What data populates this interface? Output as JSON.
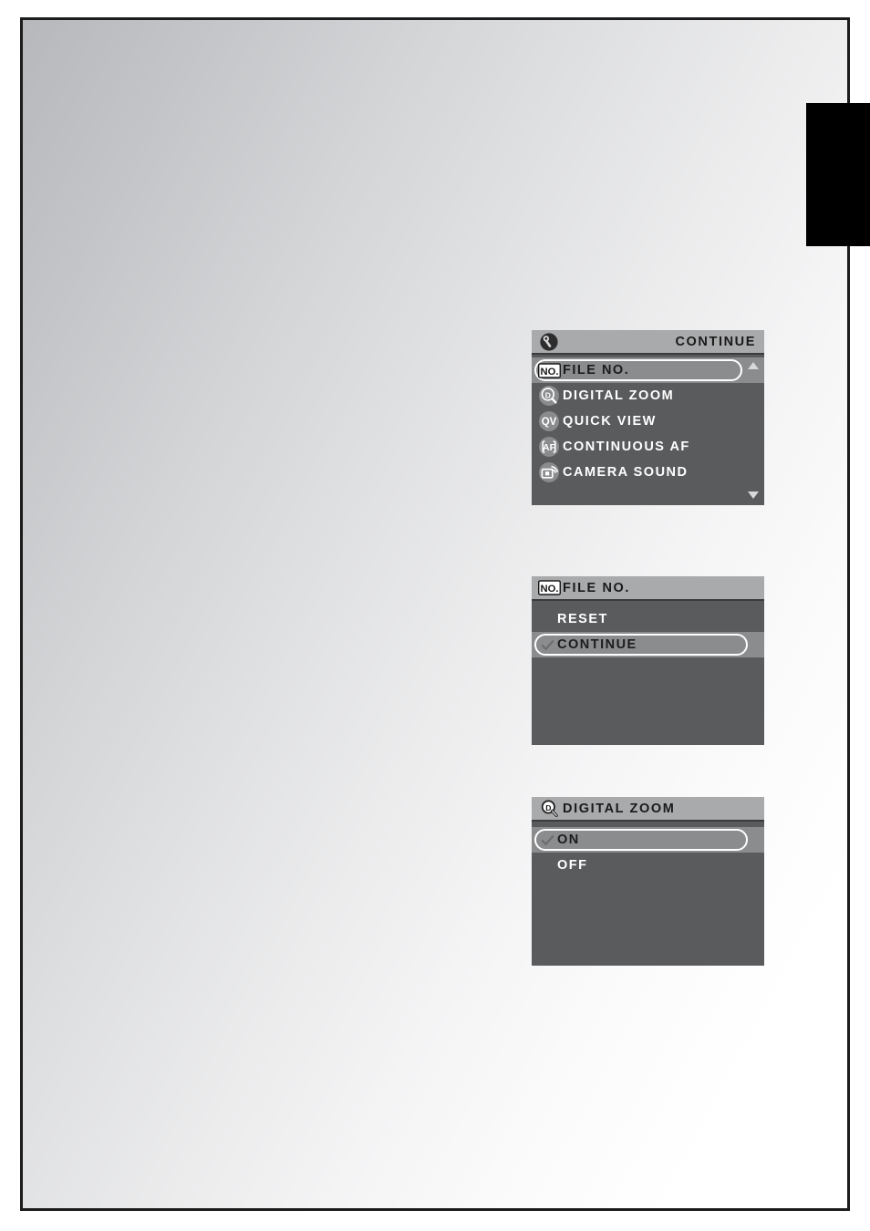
{
  "page": {
    "background_gradient_from": "#b6b8bb",
    "background_gradient_to": "#ffffff",
    "border_color": "#1c1c1c"
  },
  "edge_tab": {
    "color": "#000000"
  },
  "panels": [
    {
      "id": "setup-menu",
      "header": {
        "icon": "wrench-icon",
        "title": "CONTINUE",
        "title_align": "right",
        "background": "#a9aaab"
      },
      "rows": [
        {
          "icon": "file-no-icon",
          "label": "FILE NO.",
          "selected": true,
          "check": false
        },
        {
          "icon": "digital-zoom-icon",
          "label": "DIGITAL ZOOM",
          "selected": false,
          "check": false
        },
        {
          "icon": "quick-view-icon",
          "label": "QUICK VIEW",
          "selected": false,
          "check": false
        },
        {
          "icon": "continuous-af-icon",
          "label": "CONTINUOUS AF",
          "selected": false,
          "check": false
        },
        {
          "icon": "camera-sound-icon",
          "label": "CAMERA SOUND",
          "selected": false,
          "check": false
        }
      ],
      "scroll": {
        "up": true,
        "down": true
      }
    },
    {
      "id": "file-no-submenu",
      "header": {
        "icon": "file-no-icon",
        "title": "FILE NO.",
        "title_align": "left",
        "background": "#a9aaab"
      },
      "rows": [
        {
          "icon": null,
          "label": "RESET",
          "selected": false,
          "check": false
        },
        {
          "icon": null,
          "label": "CONTINUE",
          "selected": true,
          "check": true
        }
      ],
      "scroll": {
        "up": false,
        "down": false
      }
    },
    {
      "id": "digital-zoom-submenu",
      "header": {
        "icon": "digital-zoom-icon",
        "title": "DIGITAL ZOOM",
        "title_align": "left",
        "background": "#a9aaab"
      },
      "rows": [
        {
          "icon": null,
          "label": "ON",
          "selected": true,
          "check": true
        },
        {
          "icon": null,
          "label": "OFF",
          "selected": false,
          "check": false
        }
      ],
      "scroll": {
        "up": false,
        "down": false
      }
    }
  ]
}
